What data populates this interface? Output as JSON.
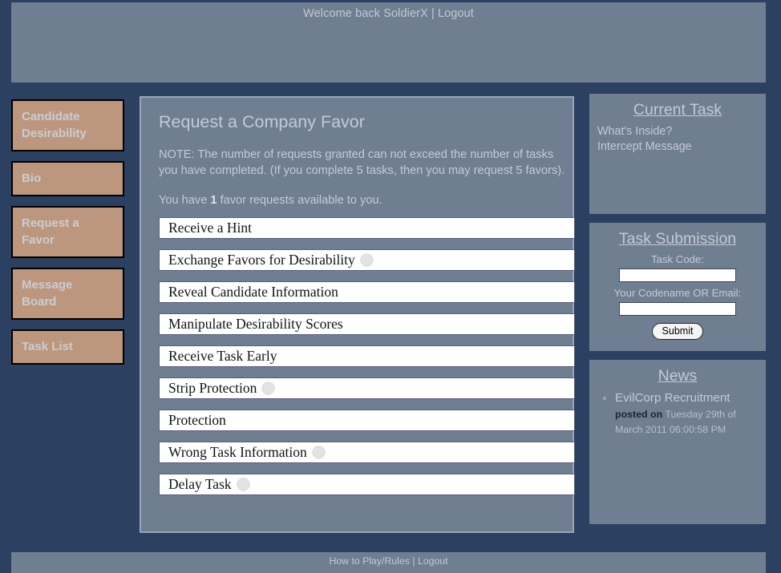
{
  "header": {
    "welcome_text": "Welcome back SoldierX",
    "separator": " | ",
    "logout_label": "Logout"
  },
  "sidebar": {
    "items": [
      {
        "label": "Candidate Desirability"
      },
      {
        "label": "Bio"
      },
      {
        "label": "Request a Favor"
      },
      {
        "label": "Message Board"
      },
      {
        "label": "Task List"
      }
    ]
  },
  "main": {
    "title": "Request a Company Favor",
    "note": "NOTE: The number of requests granted can not exceed the number of tasks you have completed. (If you complete 5 tasks, then you may request 5 favors).",
    "favor_count_prefix": "You have ",
    "favor_count_value": "1",
    "favor_count_suffix": " favor requests available to you.",
    "favors": [
      {
        "label": "Receive a Hint",
        "badge": false
      },
      {
        "label": "Exchange Favors for Desirability",
        "badge": true
      },
      {
        "label": "Reveal Candidate Information",
        "badge": false
      },
      {
        "label": "Manipulate Desirability Scores",
        "badge": false
      },
      {
        "label": "Receive Task Early",
        "badge": false
      },
      {
        "label": "Strip Protection",
        "badge": true
      },
      {
        "label": "Protection",
        "badge": false
      },
      {
        "label": "Wrong Task Information",
        "badge": true
      },
      {
        "label": "Delay Task",
        "badge": true
      }
    ]
  },
  "current_task": {
    "title": "Current Task",
    "line1": "What's Inside?",
    "line2": "Intercept Message"
  },
  "task_submission": {
    "title": "Task Submission",
    "task_code_label": "Task Code:",
    "task_code_value": "",
    "codename_label": "Your Codename OR Email:",
    "codename_value": "",
    "submit_label": "Submit"
  },
  "news": {
    "title": "News",
    "items": [
      {
        "headline": "EvilCorp Recruitment",
        "posted_label": "posted on",
        "posted_date": " Tuesday 29th of March 2011 06:00:58 PM"
      }
    ]
  },
  "footer": {
    "rules_label": "How to Play/Rules",
    "separator": " | ",
    "logout_label": "Logout"
  },
  "colors": {
    "page_background": "#2c4061",
    "panel_background": "#707e92",
    "nav_button": "#bd977d",
    "text_light": "#c3cad5",
    "list_item_background": "#ffffff"
  }
}
